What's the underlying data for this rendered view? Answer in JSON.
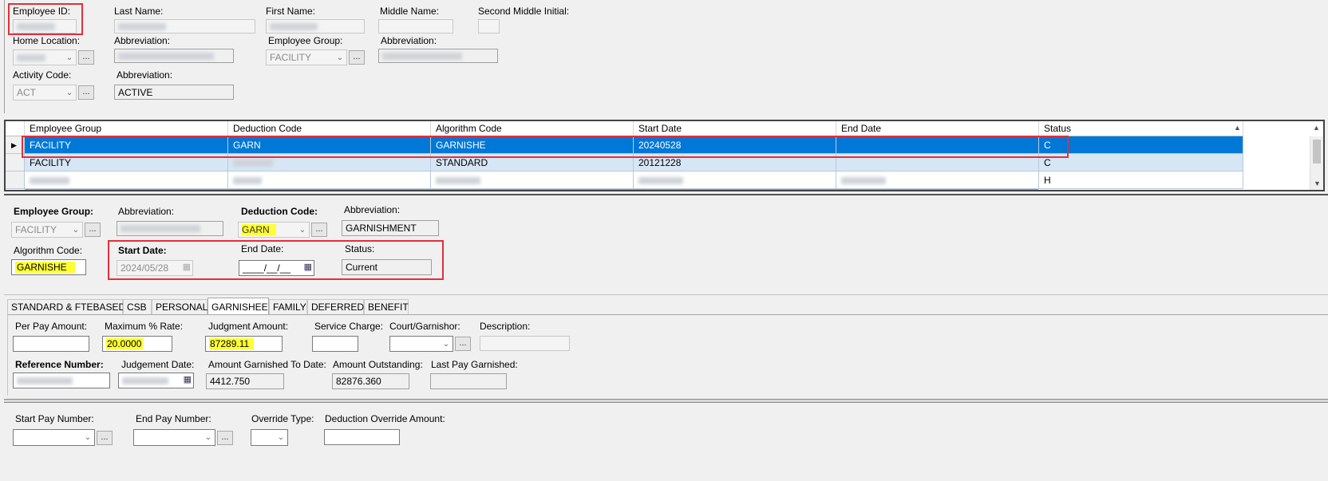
{
  "header": {
    "employee_id_label": "Employee ID:",
    "last_name_label": "Last Name:",
    "first_name_label": "First Name:",
    "middle_name_label": "Middle Name:",
    "second_middle_initial_label": "Second Middle Initial:",
    "home_location_label": "Home Location:",
    "abbreviation_label_1": "Abbreviation:",
    "employee_group_label": "Employee Group:",
    "employee_group_value": "FACILITY",
    "abbreviation_label_2": "Abbreviation:",
    "activity_code_label": "Activity Code:",
    "activity_code_value": "ACT",
    "abbreviation_label_3": "Abbreviation:",
    "activity_abbreviation_value": "ACTIVE"
  },
  "grid": {
    "columns": [
      "Employee Group",
      "Deduction Code",
      "Algorithm Code",
      "Start Date",
      "End Date",
      "Status"
    ],
    "rows": [
      {
        "employee_group": "FACILITY",
        "deduction_code": "GARN",
        "algorithm_code": "GARNISHE",
        "start_date": "20240528",
        "end_date": "",
        "status": "C",
        "selected": true
      },
      {
        "employee_group": "FACILITY",
        "deduction_code": "",
        "algorithm_code": "STANDARD",
        "start_date": "20121228",
        "end_date": "",
        "status": "C",
        "selected": false
      },
      {
        "employee_group": "",
        "deduction_code": "",
        "algorithm_code": "",
        "start_date": "",
        "end_date": "",
        "status": "H",
        "selected": false
      }
    ]
  },
  "detail": {
    "employee_group_label": "Employee Group:",
    "employee_group_value": "FACILITY",
    "abbreviation_label_1": "Abbreviation:",
    "deduction_code_label": "Deduction Code:",
    "deduction_code_value": "GARN",
    "abbreviation_label_2": "Abbreviation:",
    "deduction_abbreviation_value": "GARNISHMENT",
    "algorithm_code_label": "Algorithm Code:",
    "algorithm_code_value": "GARNISHE",
    "start_date_label": "Start Date:",
    "start_date_value": "2024/05/28",
    "end_date_label": "End Date:",
    "end_date_value": "____/__/__",
    "status_label": "Status:",
    "status_value": "Current"
  },
  "tabs": [
    {
      "label": "STANDARD & FTEBASED",
      "active": false
    },
    {
      "label": "CSB",
      "active": false
    },
    {
      "label": "PERSONAL",
      "active": false
    },
    {
      "label": "GARNISHEE",
      "active": true
    },
    {
      "label": "FAMILY",
      "active": false
    },
    {
      "label": "DEFERRED",
      "active": false
    },
    {
      "label": "BENEFIT",
      "active": false
    }
  ],
  "garnishee": {
    "per_pay_amount_label": "Per Pay Amount:",
    "per_pay_amount_value": "",
    "max_rate_label": "Maximum % Rate:",
    "max_rate_value": "20.0000",
    "judgment_amount_label": "Judgment Amount:",
    "judgment_amount_value": "87289.11",
    "service_charge_label": "Service Charge:",
    "service_charge_value": "",
    "court_label": "Court/Garnishor:",
    "description_label": "Description:",
    "reference_number_label": "Reference Number:",
    "judgement_date_label": "Judgement Date:",
    "amount_garnished_label": "Amount Garnished To Date:",
    "amount_garnished_value": "4412.750",
    "amount_outstanding_label": "Amount Outstanding:",
    "amount_outstanding_value": "82876.360",
    "last_pay_garnished_label": "Last Pay Garnished:",
    "last_pay_garnished_value": ""
  },
  "override": {
    "start_pay_label": "Start Pay Number:",
    "end_pay_label": "End Pay Number:",
    "override_type_label": "Override Type:",
    "deduction_override_label": "Deduction Override Amount:",
    "deduction_override_value": ""
  },
  "icons": {
    "ellipsis": "...",
    "dropdown": "⌄",
    "calendar": "▦"
  }
}
